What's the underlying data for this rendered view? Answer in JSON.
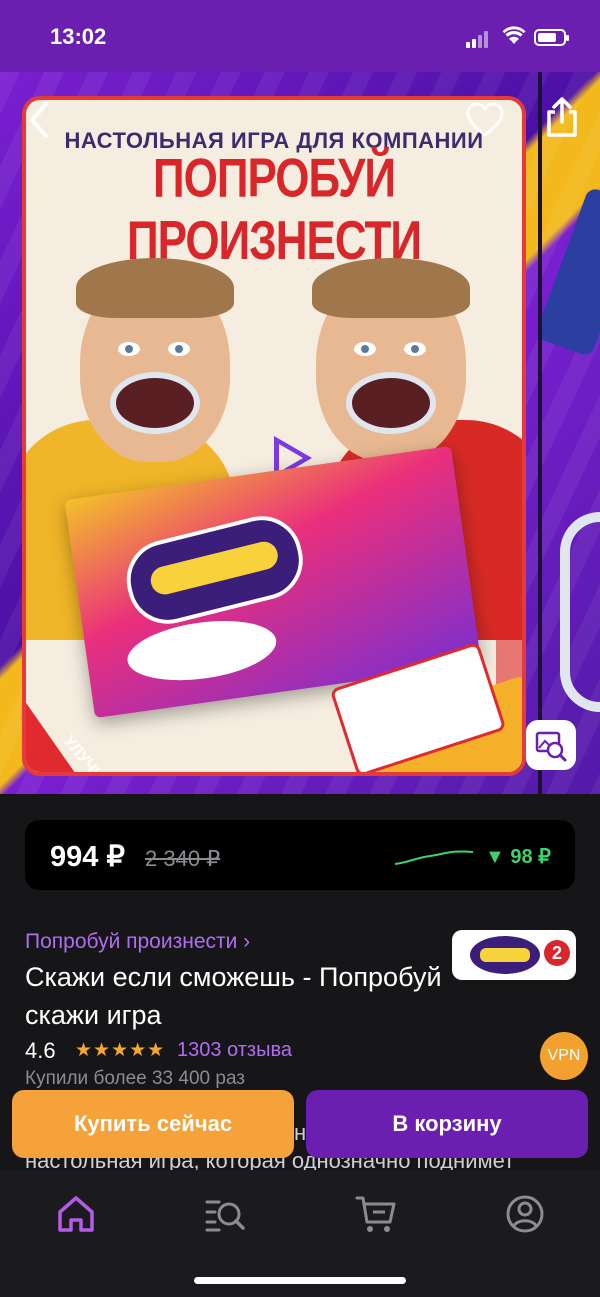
{
  "status_bar": {
    "time": "13:02"
  },
  "hero": {
    "card_subtitle": "НАСТОЛЬНАЯ ИГРА ДЛЯ КОМПАНИИ",
    "card_title": "ПОПРОБУЙ ПРОИЗНЕСТИ",
    "ribbon_text": "УЛУЧШЕННАЯ ВЕРСИЯ"
  },
  "price": {
    "current": "994 ₽",
    "old": "2 340 ₽",
    "drop": "▼ 98 ₽",
    "drop_color": "#3fd26a"
  },
  "product": {
    "brand": "Попробуй произнести ›",
    "title": "Скажи если сможешь - Попробуй скажи игра",
    "rating": "4.6",
    "stars": "★★★★★",
    "reviews": "1303 отзыва",
    "bought": "Купили более 33 400 раз",
    "description_line_partial": "н",
    "description_line2": "настольная игра, которая однозначно поднимет"
  },
  "brand_logo": {
    "number": "2"
  },
  "vpn_badge": "VPN",
  "actions": {
    "buy_now": "Купить сейчас",
    "add_to_cart": "В корзину"
  },
  "tabs": [
    {
      "icon": "home-icon",
      "active": true
    },
    {
      "icon": "catalog-search-icon",
      "active": false
    },
    {
      "icon": "cart-icon",
      "active": false
    },
    {
      "icon": "profile-icon",
      "active": false
    }
  ],
  "colors": {
    "brand_purple": "#6b1fb0",
    "accent_orange": "#f5a23a",
    "link_purple": "#b16cf0",
    "star": "#f4a630"
  }
}
